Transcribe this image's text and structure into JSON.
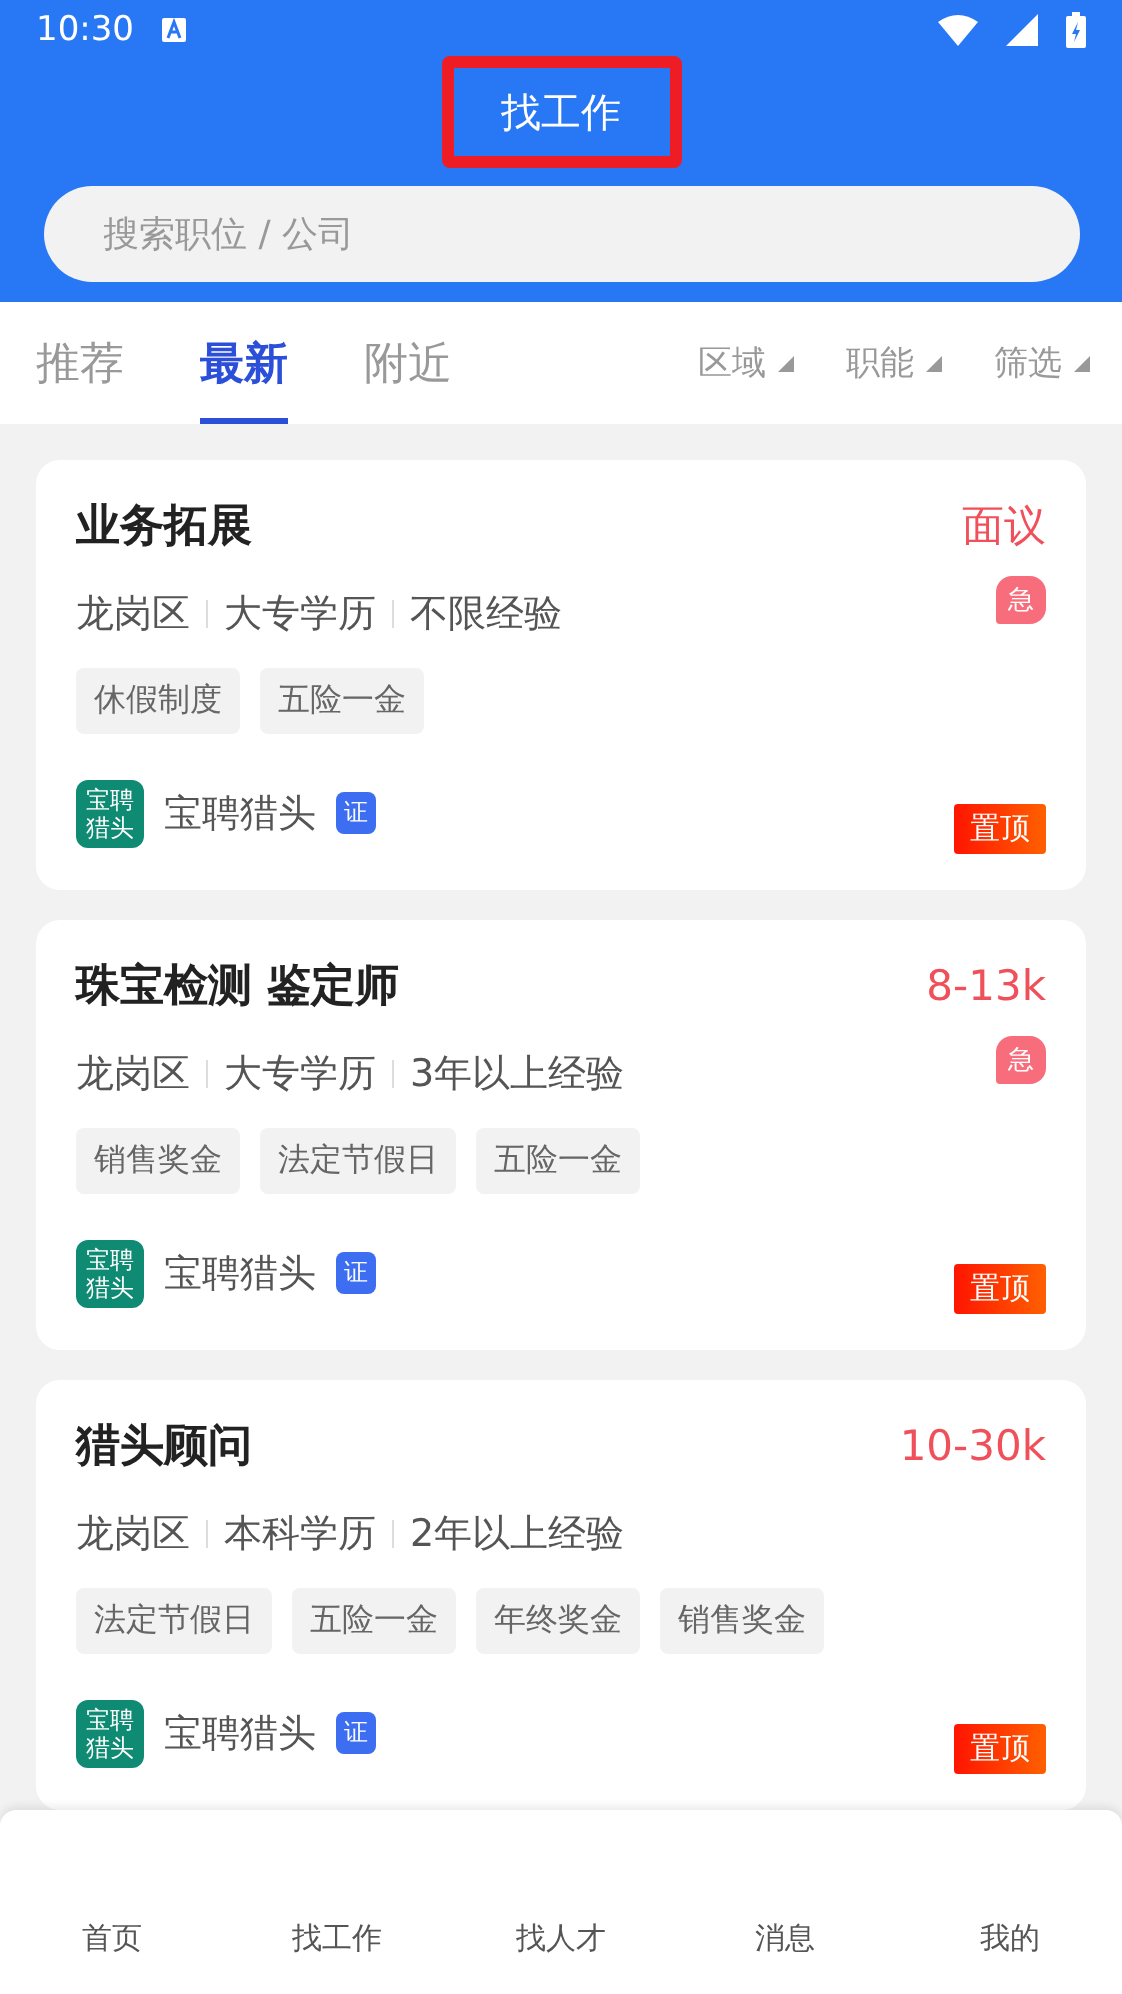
{
  "status_bar": {
    "time": "10:30"
  },
  "header": {
    "title": "找工作",
    "highlighted": true
  },
  "search": {
    "placeholder": "搜索职位 / 公司"
  },
  "tabs": [
    {
      "label": "推荐",
      "selected": false
    },
    {
      "label": "最新",
      "selected": true
    },
    {
      "label": "附近",
      "selected": false
    }
  ],
  "filters": [
    "区域",
    "职能",
    "筛选"
  ],
  "jobs": [
    {
      "title": "业务拓展",
      "salary": "面议",
      "meta": [
        "龙岗区",
        "大专学历",
        "不限经验"
      ],
      "urgent": true,
      "urgent_label": "急",
      "tags": [
        "休假制度",
        "五险一金"
      ],
      "logo_text": "宝聘猎头",
      "company": "宝聘猎头",
      "verified_label": "证",
      "pinned_label": "置顶"
    },
    {
      "title": "珠宝检测 鉴定师",
      "salary": "8-13k",
      "meta": [
        "龙岗区",
        "大专学历",
        "3年以上经验"
      ],
      "urgent": true,
      "urgent_label": "急",
      "tags": [
        "销售奖金",
        "法定节假日",
        "五险一金"
      ],
      "logo_text": "宝聘猎头",
      "company": "宝聘猎头",
      "verified_label": "证",
      "pinned_label": "置顶"
    },
    {
      "title": "猎头顾问",
      "salary": "10-30k",
      "meta": [
        "龙岗区",
        "本科学历",
        "2年以上经验"
      ],
      "urgent": false,
      "tags": [
        "法定节假日",
        "五险一金",
        "年终奖金",
        "销售奖金"
      ],
      "logo_text": "宝聘猎头",
      "company": "宝聘猎头",
      "verified_label": "证",
      "pinned_label": "置顶"
    }
  ],
  "bottom_nav": [
    {
      "label": "首页"
    },
    {
      "label": "找工作"
    },
    {
      "label": "找人才"
    },
    {
      "label": "消息"
    },
    {
      "label": "我的"
    }
  ]
}
